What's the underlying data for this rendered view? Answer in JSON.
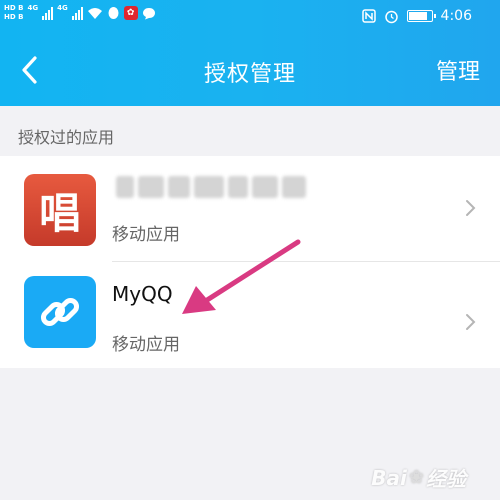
{
  "status_bar": {
    "sim_labels": [
      "HD",
      "HD"
    ],
    "sim_marks": [
      "B",
      "B"
    ],
    "network": "4G",
    "time": "4:06",
    "battery_level": 0.85
  },
  "nav": {
    "title": "授权管理",
    "manage_label": "管理"
  },
  "section": {
    "label": "授权过的应用"
  },
  "apps": [
    {
      "icon_glyph": "唱",
      "icon_color": "#d94a33",
      "type": "移动应用",
      "name_obscured": true
    },
    {
      "name": "MyQQ",
      "icon_color": "#1aaaf5",
      "type": "移动应用"
    }
  ],
  "colors": {
    "header": "#18b0f0",
    "annotation_arrow": "#d93a82"
  },
  "icons": {
    "back": "chevron-left-icon",
    "row_chevron": "chevron-right-icon",
    "link": "link-icon"
  },
  "watermark": {
    "text_left": "Bai",
    "text_right": "经验"
  }
}
